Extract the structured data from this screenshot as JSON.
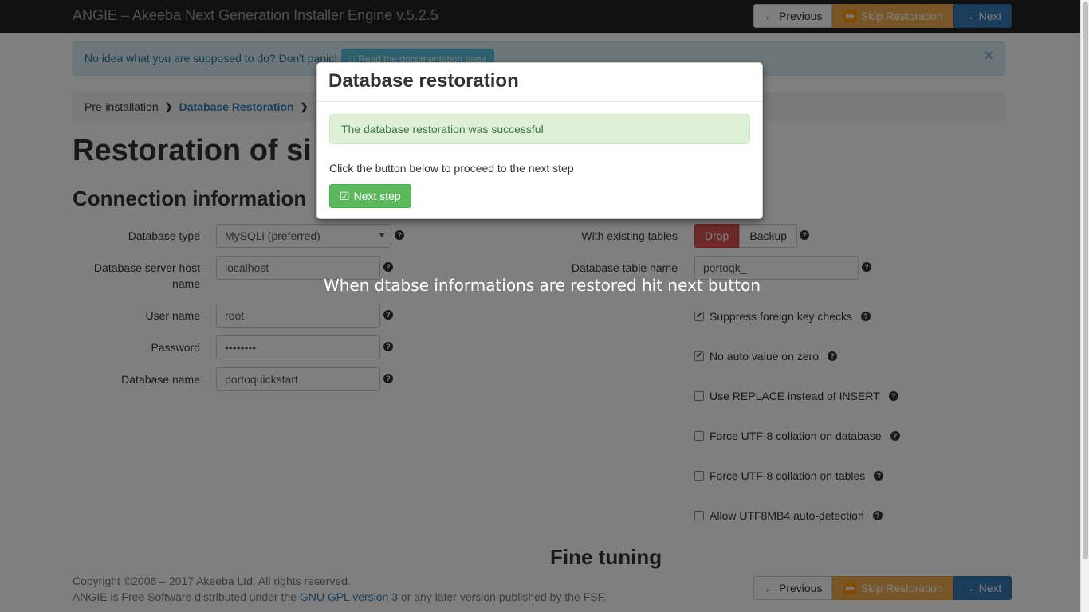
{
  "navbar": {
    "title": "ANGIE – Akeeba Next Generation Installer Engine v.5.2.5",
    "previous_label": "Previous",
    "skip_label": "Skip Restoration",
    "next_label": "Next"
  },
  "info_alert": {
    "message": "No idea what you are supposed to do? Don't panic!",
    "doc_button": "Read the documentation page",
    "close": "×"
  },
  "breadcrumb": {
    "items": [
      "Pre-installation",
      "Database Restoration"
    ]
  },
  "page_title": "Restoration of si",
  "connection": {
    "heading": "Connection information",
    "db_type_label": "Database type",
    "db_type_value": "MySQLi (preferred)",
    "host_label_1": "Database server host",
    "host_label_2": "name",
    "host_value": "localhost",
    "user_label": "User name",
    "user_value": "root",
    "password_label": "Password",
    "password_value": "••••••••",
    "dbname_label": "Database name",
    "dbname_value": "portoquickstart"
  },
  "advanced": {
    "existing_label": "With existing tables",
    "drop_label": "Drop",
    "backup_label": "Backup",
    "prefix_label": "Database table name",
    "prefix_value": "portoqk_",
    "checks": [
      {
        "label": "Suppress foreign key checks",
        "checked": true
      },
      {
        "label": "No auto value on zero",
        "checked": true
      },
      {
        "label": "Use REPLACE instead of INSERT",
        "checked": false
      },
      {
        "label": "Force UTF-8 collation on database",
        "checked": false
      },
      {
        "label": "Force UTF-8 collation on tables",
        "checked": false
      },
      {
        "label": "Allow UTF8MB4 auto-detection",
        "checked": false
      }
    ]
  },
  "fine_tuning": "Fine tuning",
  "footer": {
    "line1": "Copyright ©2006 – 2017 Akeeba Ltd. All rights reserved.",
    "line2_pre": "ANGIE is Free Software distributed under the ",
    "line2_link": "GNU GPL version 3",
    "line2_post": " or any later version published by the FSF."
  },
  "modal": {
    "title": "Database restoration",
    "success": "The database restoration was successful",
    "text": "Click the button below to proceed to the next step",
    "button": "Next step"
  },
  "caption": "When dtabse informations are restored hit next button",
  "colors": {
    "navbar": "#222222",
    "primary": "#337ab7",
    "warning": "#f0ad4e",
    "success": "#5cb85c",
    "danger": "#d9534f"
  }
}
